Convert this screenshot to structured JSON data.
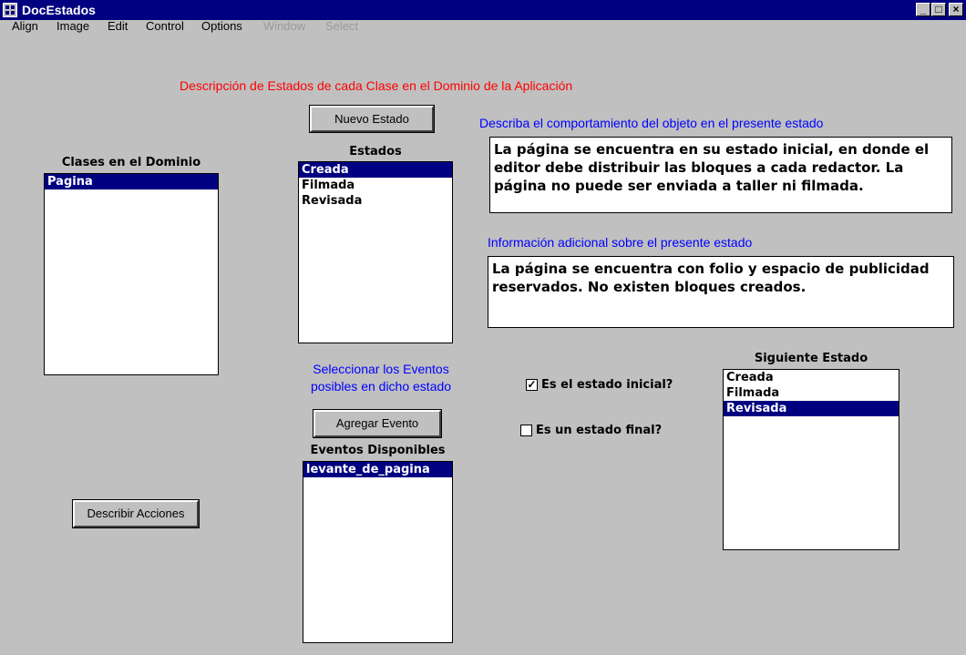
{
  "window": {
    "title": "DocEstados",
    "minimize": "_",
    "maximize": "□",
    "close": "×"
  },
  "menu": [
    "Align",
    "Image",
    "Edit",
    "Control",
    "Options",
    "Window",
    "Select"
  ],
  "heading": "Descripción de Estados de cada Clase en el Dominio de la Aplicación",
  "buttons": {
    "nuevo_estado": "Nuevo Estado",
    "agregar_evento": "Agregar Evento",
    "describir_acciones": "Describir Acciones"
  },
  "clases": {
    "label": "Clases en el Dominio",
    "items": [
      "Pagina"
    ],
    "selected": 0
  },
  "estados": {
    "label": "Estados",
    "items": [
      "Creada",
      "Filmada",
      "Revisada"
    ],
    "selected": 0
  },
  "eventos_prompt": {
    "line1": "Seleccionar los Eventos",
    "line2": "posibles en dicho estado"
  },
  "eventos": {
    "label": "Eventos Disponibles",
    "items": [
      "levante_de_pagina"
    ],
    "selected": 0
  },
  "comportamiento": {
    "label": "Describa el comportamiento del objeto en el presente estado",
    "text": "La página se encuentra en su estado inicial, en donde el editor debe distribuir las bloques a cada redactor. La página no puede ser enviada a taller ni filmada."
  },
  "info_adicional": {
    "label": "Información adicional sobre el presente estado",
    "text": "La página se encuentra con folio y espacio de publicidad reservados. No existen bloques creados."
  },
  "checkboxes": {
    "inicial": {
      "label": "Es el estado inicial?",
      "checked": true,
      "mark": "✓"
    },
    "final": {
      "label": "Es un estado final?",
      "checked": false
    }
  },
  "siguiente": {
    "label": "Siguiente Estado",
    "items": [
      "Creada",
      "Filmada",
      "Revisada"
    ],
    "selected": 2
  }
}
